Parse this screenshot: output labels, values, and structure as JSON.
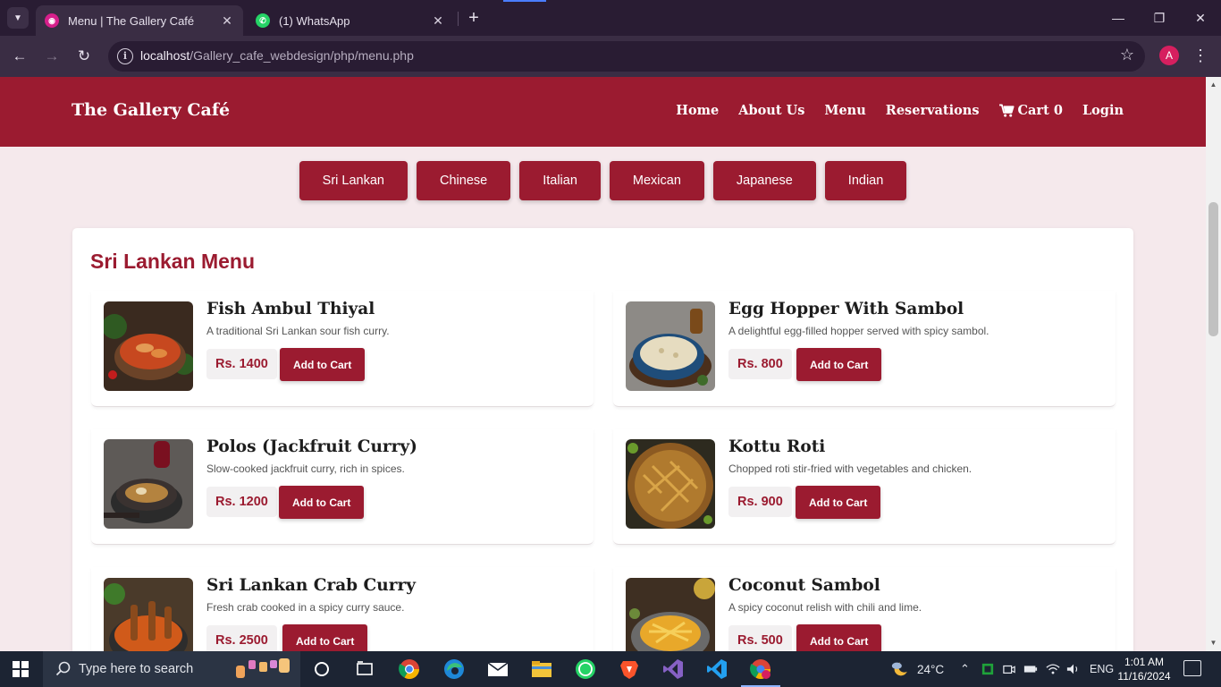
{
  "browser": {
    "tabs": [
      {
        "title": "Menu | The Gallery Café",
        "active": true
      },
      {
        "title": "(1) WhatsApp",
        "active": false
      }
    ],
    "url_host": "localhost",
    "url_path": "/Gallery_cafe_webdesign/php/menu.php",
    "profile_initial": "A"
  },
  "site": {
    "brand": "The Gallery Café",
    "nav": {
      "home": "Home",
      "about": "About Us",
      "menu": "Menu",
      "reservations": "Reservations",
      "cart_label": "Cart",
      "cart_count": "0",
      "login": "Login"
    },
    "categories": [
      "Sri Lankan",
      "Chinese",
      "Italian",
      "Mexican",
      "Japanese",
      "Indian"
    ],
    "menu_heading": "Sri Lankan Menu",
    "add_label": "Add to Cart",
    "items": [
      {
        "name": "Fish Ambul Thiyal",
        "desc": "A traditional Sri Lankan sour fish curry.",
        "price": "Rs. 1400"
      },
      {
        "name": "Egg Hopper With Sambol",
        "desc": "A delightful egg-filled hopper served with spicy sambol.",
        "price": "Rs. 800"
      },
      {
        "name": "Polos (Jackfruit Curry)",
        "desc": "Slow-cooked jackfruit curry, rich in spices.",
        "price": "Rs. 1200"
      },
      {
        "name": "Kottu Roti",
        "desc": "Chopped roti stir-fried with vegetables and chicken.",
        "price": "Rs. 900"
      },
      {
        "name": "Sri Lankan Crab Curry",
        "desc": "Fresh crab cooked in a spicy curry sauce.",
        "price": "Rs. 2500"
      },
      {
        "name": "Coconut Sambol",
        "desc": "A spicy coconut relish with chili and lime.",
        "price": "Rs. 500"
      }
    ]
  },
  "taskbar": {
    "search_placeholder": "Type here to search",
    "weather": "24°C",
    "language": "ENG",
    "time": "1:01 AM",
    "date": "11/16/2024"
  },
  "colors": {
    "brand": "#9b1b30",
    "page_bg": "#f5e9ec"
  }
}
